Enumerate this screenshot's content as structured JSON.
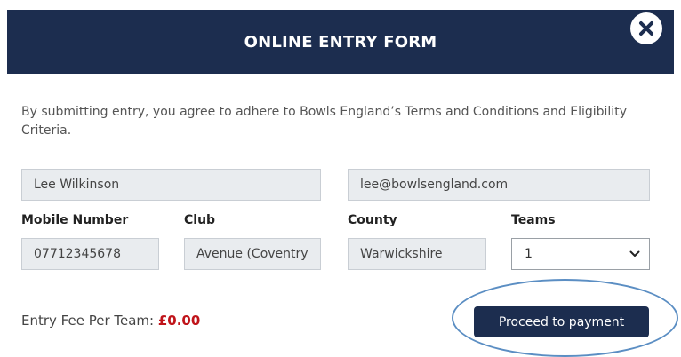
{
  "modal": {
    "title": "ONLINE ENTRY FORM",
    "close_icon": "close-icon"
  },
  "terms_text": "By submitting entry, you agree to adhere to Bowls England’s Terms and Conditions and Eligibility Criteria.",
  "fields": {
    "name_value": "Lee Wilkinson",
    "email_value": "lee@bowlsengland.com",
    "mobile_label": "Mobile Number",
    "mobile_value": "07712345678",
    "club_label": "Club",
    "club_value": "Avenue (Coventry",
    "county_label": "County",
    "county_value": "Warwickshire",
    "teams_label": "Teams",
    "teams_value": "1",
    "teams_icon": "chevron-down-icon"
  },
  "fee": {
    "label": "Entry Fee Per Team: ",
    "amount": "£0.00"
  },
  "actions": {
    "proceed_label": "Proceed to payment"
  },
  "colors": {
    "header_bg": "#1c2d4f",
    "button_bg": "#1c2d4f",
    "fee_amount": "#c0141a",
    "highlight_ring": "#5b8ec3",
    "readonly_field_bg": "#e9ecef"
  }
}
